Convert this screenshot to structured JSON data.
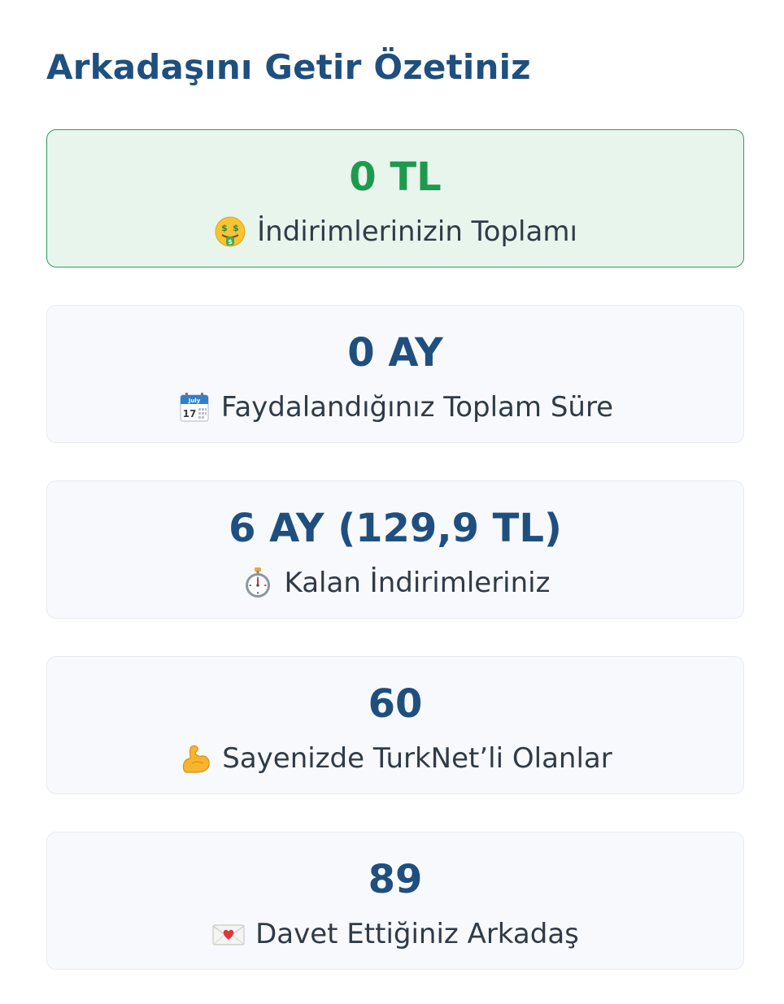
{
  "page": {
    "title": "Arkadaşını Getir Özetiniz"
  },
  "cards": [
    {
      "value": "0 TL",
      "label": "İndirimlerinizin Toplamı",
      "icon": "money-mouth-face-icon"
    },
    {
      "value": "0 AY",
      "label": "Faydalandığınız Toplam Süre",
      "icon": "calendar-icon",
      "icon_text": {
        "month": "July",
        "day": "17"
      }
    },
    {
      "value": "6 AY (129,9 TL)",
      "label": "Kalan İndirimleriniz",
      "icon": "stopwatch-icon"
    },
    {
      "value": "60",
      "label": "Sayenizde TurkNet’li Olanlar",
      "icon": "flexed-biceps-icon"
    },
    {
      "value": "89",
      "label": "Davet Ettiğiniz Arkadaş",
      "icon": "love-letter-icon"
    }
  ],
  "colors": {
    "title": "#1f4f7f",
    "value": "#1f4f7f",
    "highlight_value": "#1f9a4d",
    "highlight_bg": "#e8f5ed",
    "highlight_border": "#2e9d5b",
    "card_bg": "#f7f9fc",
    "card_border": "#e7ebf1"
  }
}
